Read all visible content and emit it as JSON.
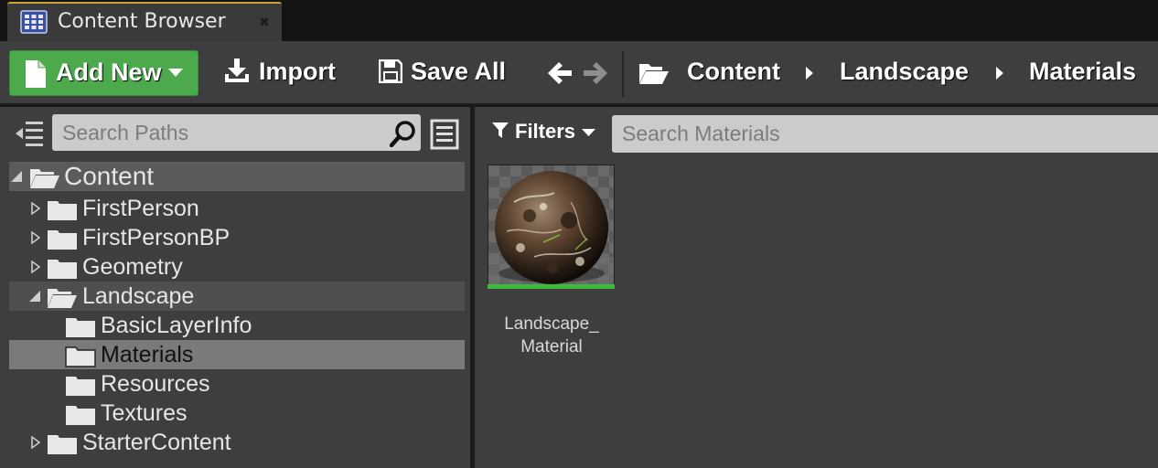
{
  "tab": {
    "title": "Content Browser",
    "icon": "content-browser-icon",
    "close_glyph": "✖"
  },
  "toolbar": {
    "add_new_label": "Add New",
    "import_label": "Import",
    "save_all_label": "Save All",
    "breadcrumb": [
      "Content",
      "Landscape",
      "Materials"
    ]
  },
  "sources": {
    "search_placeholder": "Search Paths",
    "tree": [
      {
        "label": "Content",
        "state": "expanded",
        "level": 0
      },
      {
        "label": "FirstPerson",
        "state": "collapsed",
        "level": 1
      },
      {
        "label": "FirstPersonBP",
        "state": "collapsed",
        "level": 1
      },
      {
        "label": "Geometry",
        "state": "collapsed",
        "level": 1
      },
      {
        "label": "Landscape",
        "state": "expanded",
        "level": 1
      },
      {
        "label": "BasicLayerInfo",
        "state": "leaf",
        "level": 2
      },
      {
        "label": "Materials",
        "state": "selected",
        "level": 2
      },
      {
        "label": "Resources",
        "state": "leaf",
        "level": 2
      },
      {
        "label": "Textures",
        "state": "leaf",
        "level": 2
      },
      {
        "label": "StarterContent",
        "state": "collapsed",
        "level": 1
      }
    ]
  },
  "assets_panel": {
    "filters_label": "Filters",
    "search_placeholder": "Search Materials",
    "assets": [
      {
        "name_line1": "Landscape_",
        "name_line2": "Material",
        "type_color": "#3dbb3d"
      }
    ]
  },
  "colors": {
    "accent_green": "#4caa4c",
    "tab_highlight": "#c8a52c",
    "selection": "#7a7a7a"
  }
}
